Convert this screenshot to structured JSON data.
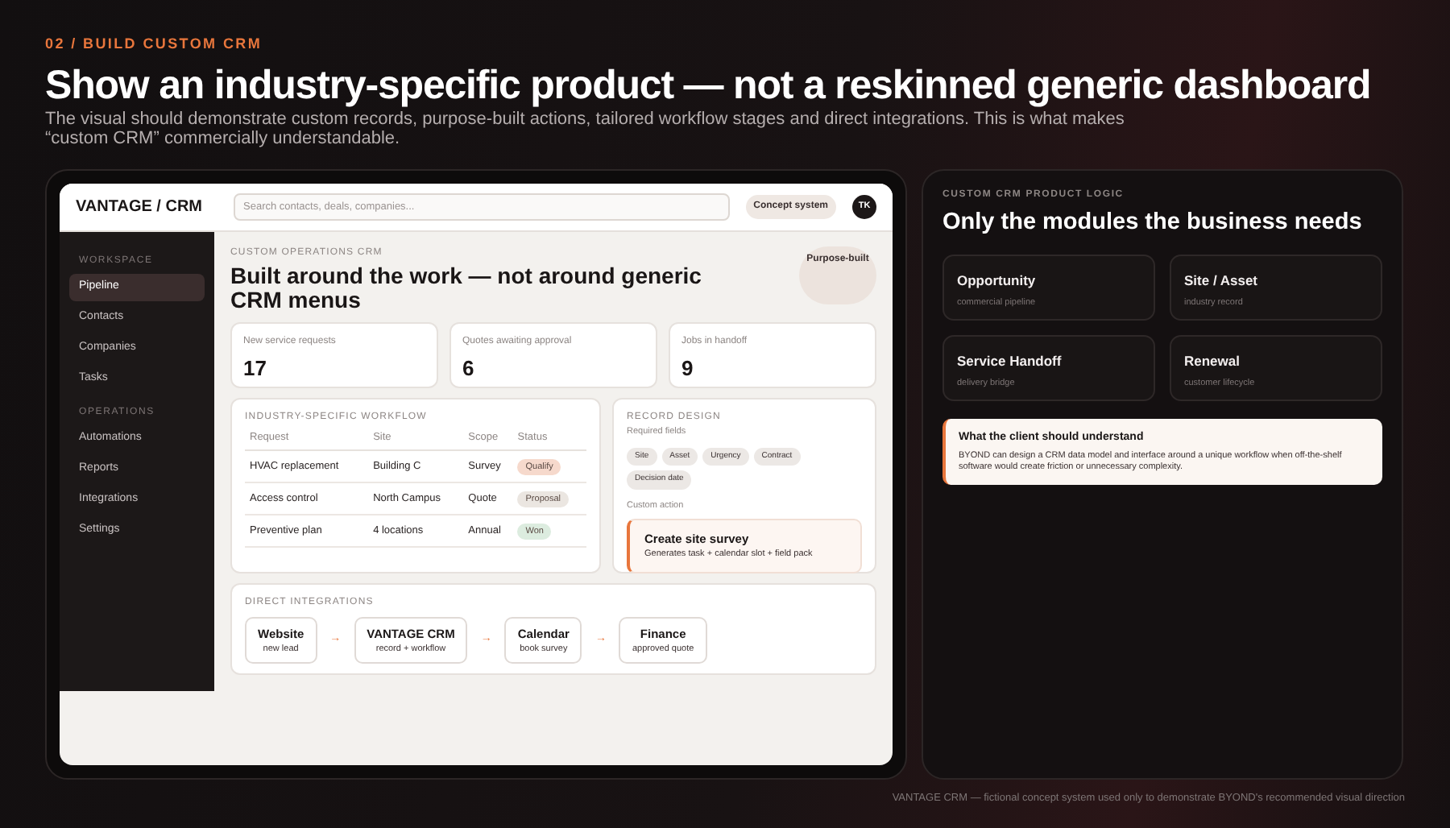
{
  "header": {
    "eyebrow": "02 / BUILD CUSTOM CRM",
    "title": "Show an industry-specific product — not a reskinned generic dashboard",
    "subtitle": "The visual should demonstrate custom records, purpose-built actions, tailored workflow stages and direct integrations. This is what makes “custom CRM” commercially understandable."
  },
  "app": {
    "logo": "VANTAGE / CRM",
    "search": {
      "placeholder": "Search contacts, deals, companies..."
    },
    "badge": "Concept system",
    "avatar": "TK",
    "sidebar": [
      {
        "heading": "WORKSPACE",
        "items": [
          {
            "label": "Pipeline",
            "selected": true
          },
          {
            "label": "Contacts",
            "selected": false
          },
          {
            "label": "Companies",
            "selected": false
          },
          {
            "label": "Tasks",
            "selected": false
          }
        ]
      },
      {
        "heading": "OPERATIONS",
        "items": [
          {
            "label": "Automations",
            "selected": false
          },
          {
            "label": "Reports",
            "selected": false
          },
          {
            "label": "Integrations",
            "selected": false
          },
          {
            "label": "Settings",
            "selected": false
          }
        ]
      }
    ],
    "eyebrow": "CUSTOM OPERATIONS CRM",
    "title": "Built around the work — not around generic CRM menus",
    "tag": "Purpose-built",
    "stats": [
      {
        "label": "New service requests",
        "value": "17"
      },
      {
        "label": "Quotes awaiting approval",
        "value": "6"
      },
      {
        "label": "Jobs in handoff",
        "value": "9"
      }
    ],
    "workflow": {
      "title": "INDUSTRY-SPECIFIC WORKFLOW",
      "columns": [
        "Request",
        "Site",
        "Scope",
        "Status"
      ],
      "rows": [
        {
          "request": "HVAC replacement",
          "site": "Building C",
          "scope": "Survey",
          "status": "Qualify",
          "color": "#f6d9cc"
        },
        {
          "request": "Access control",
          "site": "North Campus",
          "scope": "Quote",
          "status": "Proposal",
          "color": "#ebe6e1"
        },
        {
          "request": "Preventive plan",
          "site": "4 locations",
          "scope": "Annual",
          "status": "Won",
          "color": "#dcecdf"
        }
      ]
    },
    "record": {
      "title": "RECORD DESIGN",
      "subtitle": "Required fields",
      "fields": [
        "Site",
        "Asset",
        "Urgency",
        "Contract",
        "Decision date"
      ],
      "action_label": "Custom action",
      "action": {
        "title": "Create site survey",
        "detail": "Generates task + calendar slot + field pack"
      }
    },
    "integrations": {
      "title": "DIRECT INTEGRATIONS",
      "arrow": "→",
      "nodes": [
        {
          "name": "Website",
          "detail": "new lead"
        },
        {
          "name": "VANTAGE CRM",
          "detail": "record + workflow"
        },
        {
          "name": "Calendar",
          "detail": "book survey"
        },
        {
          "name": "Finance",
          "detail": "approved quote"
        }
      ]
    }
  },
  "logic": {
    "eyebrow": "CUSTOM CRM PRODUCT LOGIC",
    "title": "Only the modules the business needs",
    "modules": [
      {
        "name": "Opportunity",
        "detail": "commercial pipeline"
      },
      {
        "name": "Site / Asset",
        "detail": "industry record"
      },
      {
        "name": "Service Handoff",
        "detail": "delivery bridge"
      },
      {
        "name": "Renewal",
        "detail": "customer lifecycle"
      }
    ],
    "note": {
      "title": "What the client should understand",
      "body": "BYOND can design a CRM data model and interface around a unique workflow when off-the-shelf software would create friction or unnecessary complexity."
    }
  },
  "footer": "VANTAGE CRM — fictional concept system used only to demonstrate BYOND's recommended visual direction"
}
